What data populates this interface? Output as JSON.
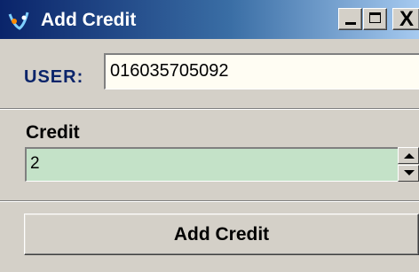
{
  "window": {
    "title": "Add Credit",
    "icon": "app-logo-icon",
    "controls": [
      "minimize-icon",
      "maximize-icon",
      "close-icon"
    ],
    "close_glyph": "X"
  },
  "user": {
    "label": "USER:",
    "value": "016035705092"
  },
  "credit": {
    "label": "Credit",
    "value": "2"
  },
  "actions": {
    "add_label": "Add Credit"
  },
  "colors": {
    "title_gradient_start": "#0a246a",
    "title_gradient_end": "#a6caf0",
    "user_label": "#0a246a",
    "credit_field_bg": "#c4e2c8",
    "user_field_bg": "#fffdf3",
    "dialog_bg": "#d4d0c8"
  }
}
